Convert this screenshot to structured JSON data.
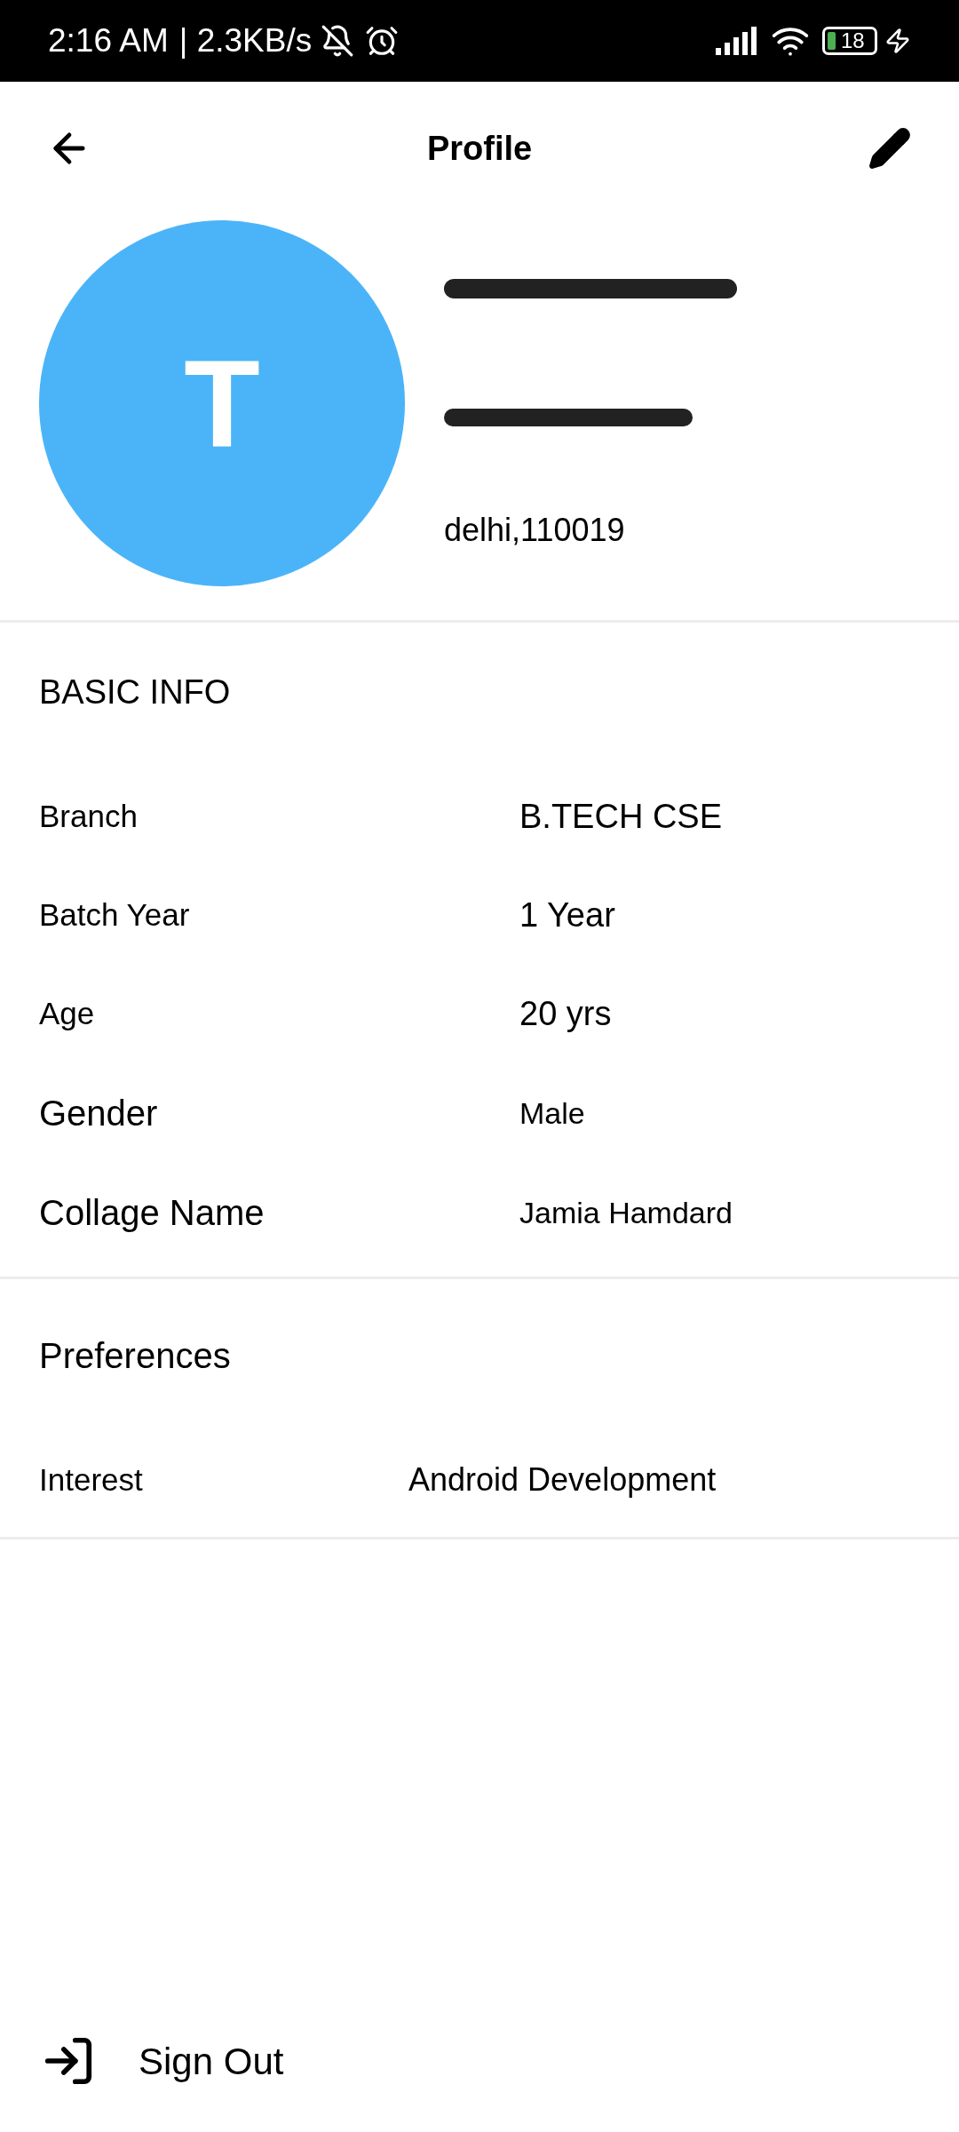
{
  "status_bar": {
    "time": "2:16 AM",
    "speed": "| 2.3KB/s",
    "battery": "18"
  },
  "header": {
    "title": "Profile"
  },
  "profile": {
    "initial": "T",
    "location": "delhi,110019"
  },
  "basic_info": {
    "title": "BASIC INFO",
    "rows": [
      {
        "label": "Branch",
        "value": "B.TECH CSE"
      },
      {
        "label": "Batch Year",
        "value": "1 Year"
      },
      {
        "label": "Age",
        "value": "20 yrs"
      },
      {
        "label": "Gender",
        "value": "Male"
      },
      {
        "label": "Collage Name",
        "value": "Jamia Hamdard"
      }
    ]
  },
  "preferences": {
    "title": "Preferences",
    "rows": [
      {
        "label": "Interest",
        "value": "Android Development"
      }
    ]
  },
  "sign_out": {
    "label": "Sign Out"
  }
}
